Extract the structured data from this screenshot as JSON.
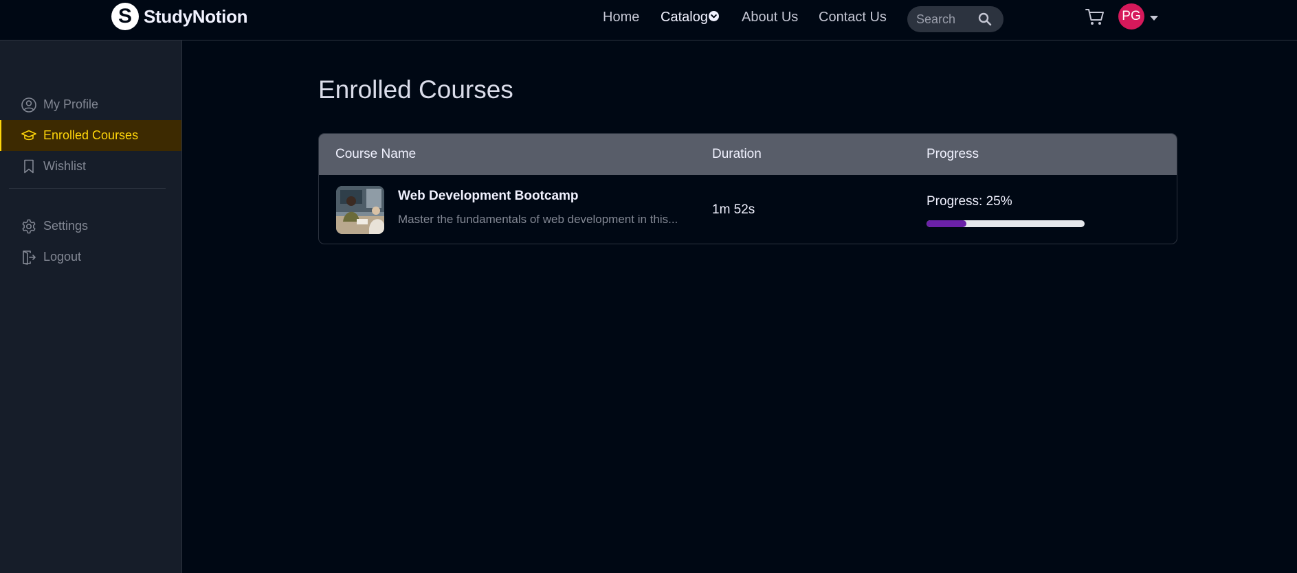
{
  "brand": {
    "name": "StudyNotion",
    "logo_letter": "S"
  },
  "nav": {
    "home": "Home",
    "catalog": "Catalog",
    "about": "About Us",
    "contact": "Contact Us"
  },
  "search": {
    "placeholder": "Search",
    "icon": "search-icon"
  },
  "user": {
    "initials": "PG",
    "avatar_color": "#d6195b"
  },
  "sidebar": {
    "items": [
      {
        "label": "My Profile",
        "icon": "user-circle-icon"
      },
      {
        "label": "Enrolled Courses",
        "icon": "graduation-cap-icon",
        "active": true
      },
      {
        "label": "Wishlist",
        "icon": "bookmark-icon"
      },
      {
        "label": "Settings",
        "icon": "gear-icon"
      },
      {
        "label": "Logout",
        "icon": "logout-icon"
      }
    ]
  },
  "page": {
    "title": "Enrolled Courses"
  },
  "table": {
    "headers": {
      "course": "Course Name",
      "duration": "Duration",
      "progress": "Progress"
    },
    "rows": [
      {
        "title": "Web Development Bootcamp",
        "description": "Master the fundamentals of web development in this...",
        "duration": "1m 52s",
        "progress_label": "Progress: 25%",
        "progress_percent": 25
      }
    ]
  },
  "colors": {
    "accent_yellow": "#ffd60a",
    "progress_fill": "#6b21a8",
    "header_bg": "#585d69"
  }
}
